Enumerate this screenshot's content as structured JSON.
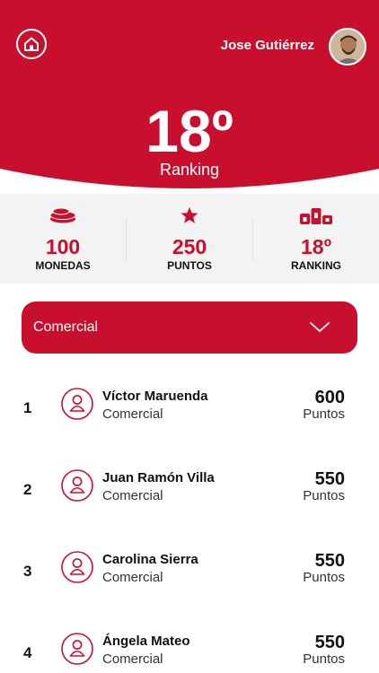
{
  "colors": {
    "brand": "#c8102e",
    "stats_bg": "#f3f3f3"
  },
  "header": {
    "home_icon": "home-icon",
    "user_name": "Jose Gutiérrez",
    "ranking_value": "18º",
    "ranking_label": "Ranking"
  },
  "stats": [
    {
      "icon": "coins-icon",
      "value": "100",
      "label": "MONEDAS"
    },
    {
      "icon": "star-icon",
      "value": "250",
      "label": "PUNTOS"
    },
    {
      "icon": "podium-icon",
      "value": "18º",
      "label": "RANKING"
    }
  ],
  "filter": {
    "selected": "Comercial",
    "icon": "chevron-down-icon"
  },
  "ranking": [
    {
      "position": "1",
      "name": "Víctor Maruenda",
      "role": "Comercial",
      "points": "600",
      "points_label": "Puntos"
    },
    {
      "position": "2",
      "name": "Juan Ramón Villa",
      "role": "Comercial",
      "points": "550",
      "points_label": "Puntos"
    },
    {
      "position": "3",
      "name": "Carolina Sierra",
      "role": "Comercial",
      "points": "550",
      "points_label": "Puntos"
    },
    {
      "position": "4",
      "name": "Ángela Mateo",
      "role": "Comercial",
      "points": "550",
      "points_label": "Puntos"
    }
  ]
}
